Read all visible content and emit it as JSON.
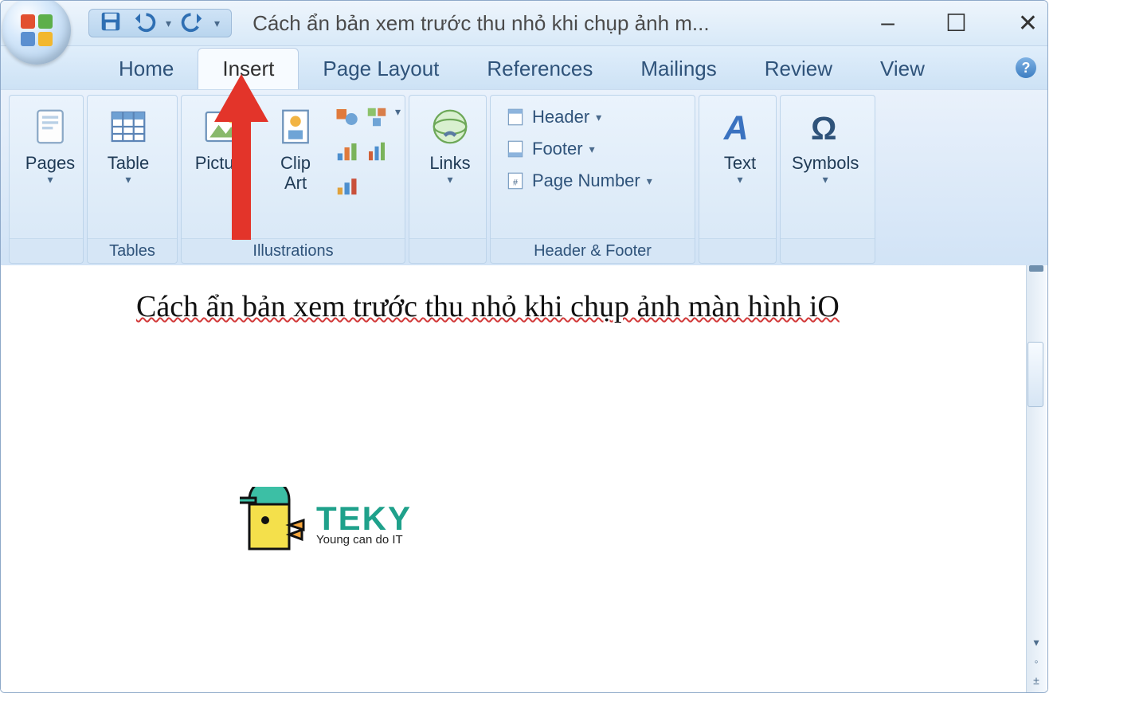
{
  "window": {
    "title": "Cách ẩn bản xem trước thu nhỏ khi chụp ảnh m...",
    "controls": {
      "minimize": "–",
      "maximize": "☐",
      "close": "✕"
    }
  },
  "qat": {
    "save": "save-icon",
    "undo": "undo-icon",
    "redo": "redo-icon",
    "customize": "▾"
  },
  "tabs": [
    {
      "id": "home",
      "label": "Home",
      "active": false
    },
    {
      "id": "insert",
      "label": "Insert",
      "active": true
    },
    {
      "id": "page-layout",
      "label": "Page Layout",
      "active": false
    },
    {
      "id": "references",
      "label": "References",
      "active": false
    },
    {
      "id": "mailings",
      "label": "Mailings",
      "active": false
    },
    {
      "id": "review",
      "label": "Review",
      "active": false
    },
    {
      "id": "view",
      "label": "View",
      "active": false
    }
  ],
  "ribbon": {
    "groups": {
      "pages": {
        "label": "",
        "items": [
          {
            "label": "Pages"
          }
        ]
      },
      "tables": {
        "label": "Tables",
        "items": [
          {
            "label": "Table"
          }
        ]
      },
      "illustrations": {
        "label": "Illustrations",
        "items": [
          {
            "label": "Picture"
          },
          {
            "label": "Clip\nArt"
          }
        ]
      },
      "links": {
        "label": "",
        "items": [
          {
            "label": "Links"
          }
        ]
      },
      "headerfooter": {
        "label": "Header & Footer",
        "items": [
          {
            "label": "Header"
          },
          {
            "label": "Footer"
          },
          {
            "label": "Page Number"
          }
        ]
      },
      "text": {
        "label": "",
        "items": [
          {
            "label": "Text"
          }
        ]
      },
      "symbols": {
        "label": "",
        "items": [
          {
            "label": "Symbols"
          }
        ]
      }
    }
  },
  "document": {
    "typed_text": "Cách ẩn bản xem trước thu nhỏ khi chụp ảnh màn hình iO"
  },
  "watermark": {
    "brand": "TEKY",
    "tagline": "Young can do IT"
  },
  "annotation": {
    "target_tab": "Insert"
  }
}
